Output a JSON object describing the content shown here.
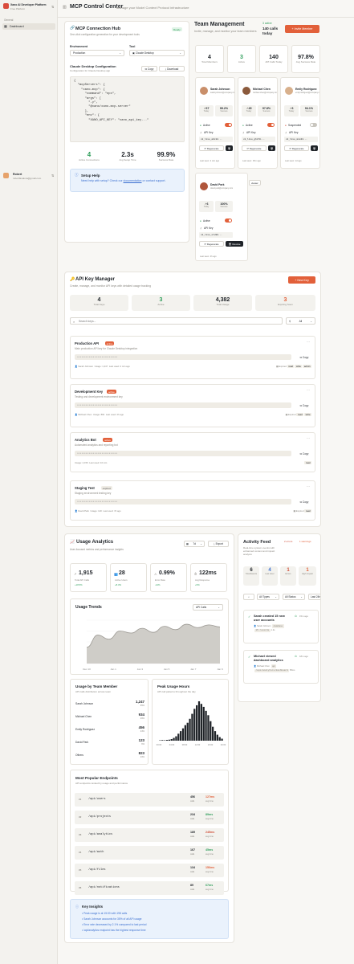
{
  "sidebar": {
    "org_name": "Xano AI Developer Platform",
    "org_plan": "Free Platform",
    "section": "General",
    "nav_dashboard": "Dashboard",
    "user_name": "Robert",
    "user_email": "robertfavalora@gmail.com"
  },
  "header": {
    "title": "MCP Control Center",
    "subtitle": "Manage your Model Context Protocol infrastructure"
  },
  "hub": {
    "title": "MCP Connection Hub",
    "badge": "Ready",
    "subtitle": "One-click configuration generation for your development tools",
    "env_label": "Environment",
    "env_value": "Production",
    "tool_label": "Tool",
    "tool_value": "Claude Desktop",
    "config_title": "Claude Desktop Configuration",
    "config_sub": "Configuration for Claude Desktop app",
    "copy": "Copy",
    "download": "Download",
    "code": "{\n  \"mcpServers\": {\n    \"xano-mcp\": {\n      \"command\": \"npx\",\n      \"args\": [\n        \"-y\",\n        \"@xano/xano-mcp-server\"\n      ],\n      \"env\": {\n        \"XANO_API_KEY\": \"xano_api_key...\"",
    "stats": [
      {
        "value": "4",
        "label": "Active Connections"
      },
      {
        "value": "2.3s",
        "label": "Avg Setup Time"
      },
      {
        "value": "99.9%",
        "label": "Success Rate"
      }
    ],
    "help_title": "Setup Help",
    "help_text": "Need help with setup? Check our",
    "help_link": "documentation",
    "help_text2": "or contact support."
  },
  "team": {
    "title": "Team Management",
    "subtitle": "Invite, manage, and monitor your team members",
    "active": "3 active",
    "calls_today": "140 calls today",
    "invite": "Invite Member",
    "stats": [
      {
        "value": "4",
        "label": "Total Members"
      },
      {
        "value": "3",
        "label": "Active"
      },
      {
        "value": "140",
        "label": "API Calls Today"
      },
      {
        "value": "97.8%",
        "label": "Avg Success Rate"
      }
    ],
    "members": [
      {
        "name": "Sarah Johnson",
        "email": "sarah.johnson@company.com",
        "today": "67",
        "rate": "99.2%",
        "status": "Active",
        "key": "xk_live_abc12...",
        "last": "Last seen: 2 min ago"
      },
      {
        "name": "Michael Chen",
        "email": "michael.chen@company.com",
        "today": "45",
        "rate": "97.8%",
        "status": "Active",
        "key": "xk_live_ghi78...",
        "last": "Last seen: 15m ago"
      },
      {
        "name": "Emily Rodriguez",
        "email": "emily.rodriguez@company.com",
        "today": "6",
        "rate": "94.1%",
        "status": "Suspended",
        "key": "xk_live_mno34...",
        "last": "Last seen: 1d ago"
      },
      {
        "name": "David Park",
        "email": "david.park@company.com",
        "today": "6",
        "rate": "100%",
        "status": "Active",
        "key": "xk_live_stu90...",
        "last": "Last seen: 4h ago",
        "badge": "viewer"
      }
    ],
    "today_label": "Today",
    "success_label": "Success",
    "api_key": "API Key",
    "regenerate": "Regenerate",
    "revoke": "Revoke"
  },
  "keys": {
    "title": "API Key Manager",
    "subtitle": "Create, manage, and monitor API keys with detailed usage tracking",
    "new": "New Key",
    "stats": [
      {
        "value": "4",
        "label": "Total Keys"
      },
      {
        "value": "3",
        "label": "Active"
      },
      {
        "value": "4,382",
        "label": "Total Usage"
      },
      {
        "value": "3",
        "label": "Expiring Soon"
      }
    ],
    "search_placeholder": "Search keys...",
    "filter": "All",
    "items": [
      {
        "name": "Production API",
        "status": "active",
        "desc": "Main production API key for Claude Desktop integration",
        "owner": "Sarah Johnson",
        "usage": "Usage: 1,247",
        "last": "Last used: 2 min ago",
        "expire": "Expired",
        "tags": [
          "read",
          "write",
          "admin"
        ]
      },
      {
        "name": "Development Key",
        "status": "active",
        "desc": "Testing and development environment key",
        "owner": "Michael Chen",
        "usage": "Usage: 892",
        "last": "Last used: 2h ago",
        "expire": "Expired",
        "tags": [
          "read",
          "write"
        ]
      },
      {
        "name": "Analytics Bot",
        "status": "active",
        "desc": "Automated analytics and reporting bot",
        "owner": "",
        "usage": "Usage: 2,156",
        "last": "Last used: 10 min",
        "expire": "",
        "tags": [
          "read"
        ]
      },
      {
        "name": "Staging Test",
        "status": "expired",
        "desc": "Staging environment testing key",
        "owner": "David Park",
        "usage": "Usage: 120",
        "last": "Last used: 7d ago",
        "expire": "Expired",
        "tags": [
          "read"
        ]
      }
    ],
    "copy": "Copy"
  },
  "usage": {
    "title": "Usage Analytics",
    "subtitle": "User-focused metrics and performance insights",
    "range": "7d",
    "export": "Export",
    "kpis": [
      {
        "value": "1,915",
        "label": "Total API Calls",
        "delta": "+18.5%"
      },
      {
        "value": "28",
        "label": "Active Users",
        "delta": "+8.3%"
      },
      {
        "value": "0.99%",
        "label": "Error Rate",
        "delta": "-12%"
      },
      {
        "value": "122ms",
        "label": "Avg Response",
        "delta": "+5%"
      }
    ],
    "trends_title": "Usage Trends",
    "trends_select": "API Calls",
    "member_title": "Usage by Team Member",
    "member_sub": "API calls distribution across team",
    "members": [
      {
        "name": "Sarah Johnson",
        "value": "1,247",
        "pct": "65%"
      },
      {
        "name": "Michael Chen",
        "value": "934",
        "pct": "49%"
      },
      {
        "name": "Emily Rodriguez",
        "value": "456",
        "pct": "24%"
      },
      {
        "name": "David Park",
        "value": "123",
        "pct": "6%"
      },
      {
        "name": "Others",
        "value": "823",
        "pct": "43%"
      }
    ],
    "peak_title": "Peak Usage Hours",
    "peak_sub": "API call patterns throughout the day",
    "endpoints_title": "Most Popular Endpoints",
    "endpoints_sub": "API endpoints ranked by usage and performance",
    "endpoints": [
      {
        "rank": "#1",
        "path": "/api/users",
        "calls": "456",
        "ms": "127ms"
      },
      {
        "rank": "#2",
        "path": "/api/projects",
        "calls": "234",
        "ms": "89ms"
      },
      {
        "rank": "#3",
        "path": "/api/analytics",
        "calls": "189",
        "ms": "245ms"
      },
      {
        "rank": "#4",
        "path": "/api/auth",
        "calls": "167",
        "ms": "45ms"
      },
      {
        "rank": "#5",
        "path": "/api/files",
        "calls": "134",
        "ms": "156ms"
      },
      {
        "rank": "#6",
        "path": "/api/notifications",
        "calls": "89",
        "ms": "67ms"
      }
    ],
    "calls_label": "calls",
    "avg_label": "avg time",
    "insights_title": "Key Insights",
    "insights": [
      "Peak usage is at 15:00 with 198 calls",
      "Sarah Johnson accounts for 35% of all API usage",
      "Error rate decreased by 2.1% compared to last period",
      "/api/analytics endpoint has the highest response time"
    ]
  },
  "activity": {
    "title": "Activity Feed",
    "subtitle": "Real-time system events with enhanced context and impact analysis",
    "errors": "2 errors",
    "warnings": "1 warnings",
    "stats": [
      {
        "value": "6",
        "label": "Total Events"
      },
      {
        "value": "4",
        "label": "Last Hour"
      },
      {
        "value": "1",
        "label": "Errors"
      },
      {
        "value": "1",
        "label": "High Impact"
      }
    ],
    "filter1": "All Types",
    "filter2": "All Status",
    "filter3": "Last 24h",
    "events": [
      {
        "title": "Sarah created 15 new user accounts",
        "time": "15m ago",
        "user": "Sarah Johnson",
        "tag": "database",
        "meta": "15 records",
        "dur": "1.2s"
      },
      {
        "title": "Michael viewed dashboard analytics",
        "time": "18m ago",
        "user": "Michael Chen",
        "tag": "api",
        "meta": "/api/analytics/dashboard",
        "dur": "85ms"
      }
    ]
  },
  "chart_data": [
    {
      "type": "area",
      "title": "Usage Trends",
      "x": [
        "Dec 10",
        "Jan 1",
        "Jan 3",
        "Jan 5",
        "Jan 7",
        "Jan 9"
      ],
      "values": [
        120,
        210,
        180,
        240,
        225,
        260,
        230,
        275,
        250,
        290,
        265,
        285,
        270
      ]
    },
    {
      "type": "bar",
      "title": "Peak Usage Hours",
      "x": [
        "00:00",
        "04:00",
        "08:00",
        "12:00",
        "16:00",
        "20:00"
      ],
      "values": [
        2,
        3,
        2,
        4,
        5,
        8,
        14,
        22,
        35,
        48,
        62,
        78,
        90,
        110,
        135,
        160,
        178,
        198,
        185,
        170,
        150,
        128,
        98,
        70,
        48,
        30,
        18,
        10
      ]
    }
  ],
  "colors": {
    "accent": "#e2603a",
    "green": "#2f9e5b",
    "red": "#d0503a"
  }
}
